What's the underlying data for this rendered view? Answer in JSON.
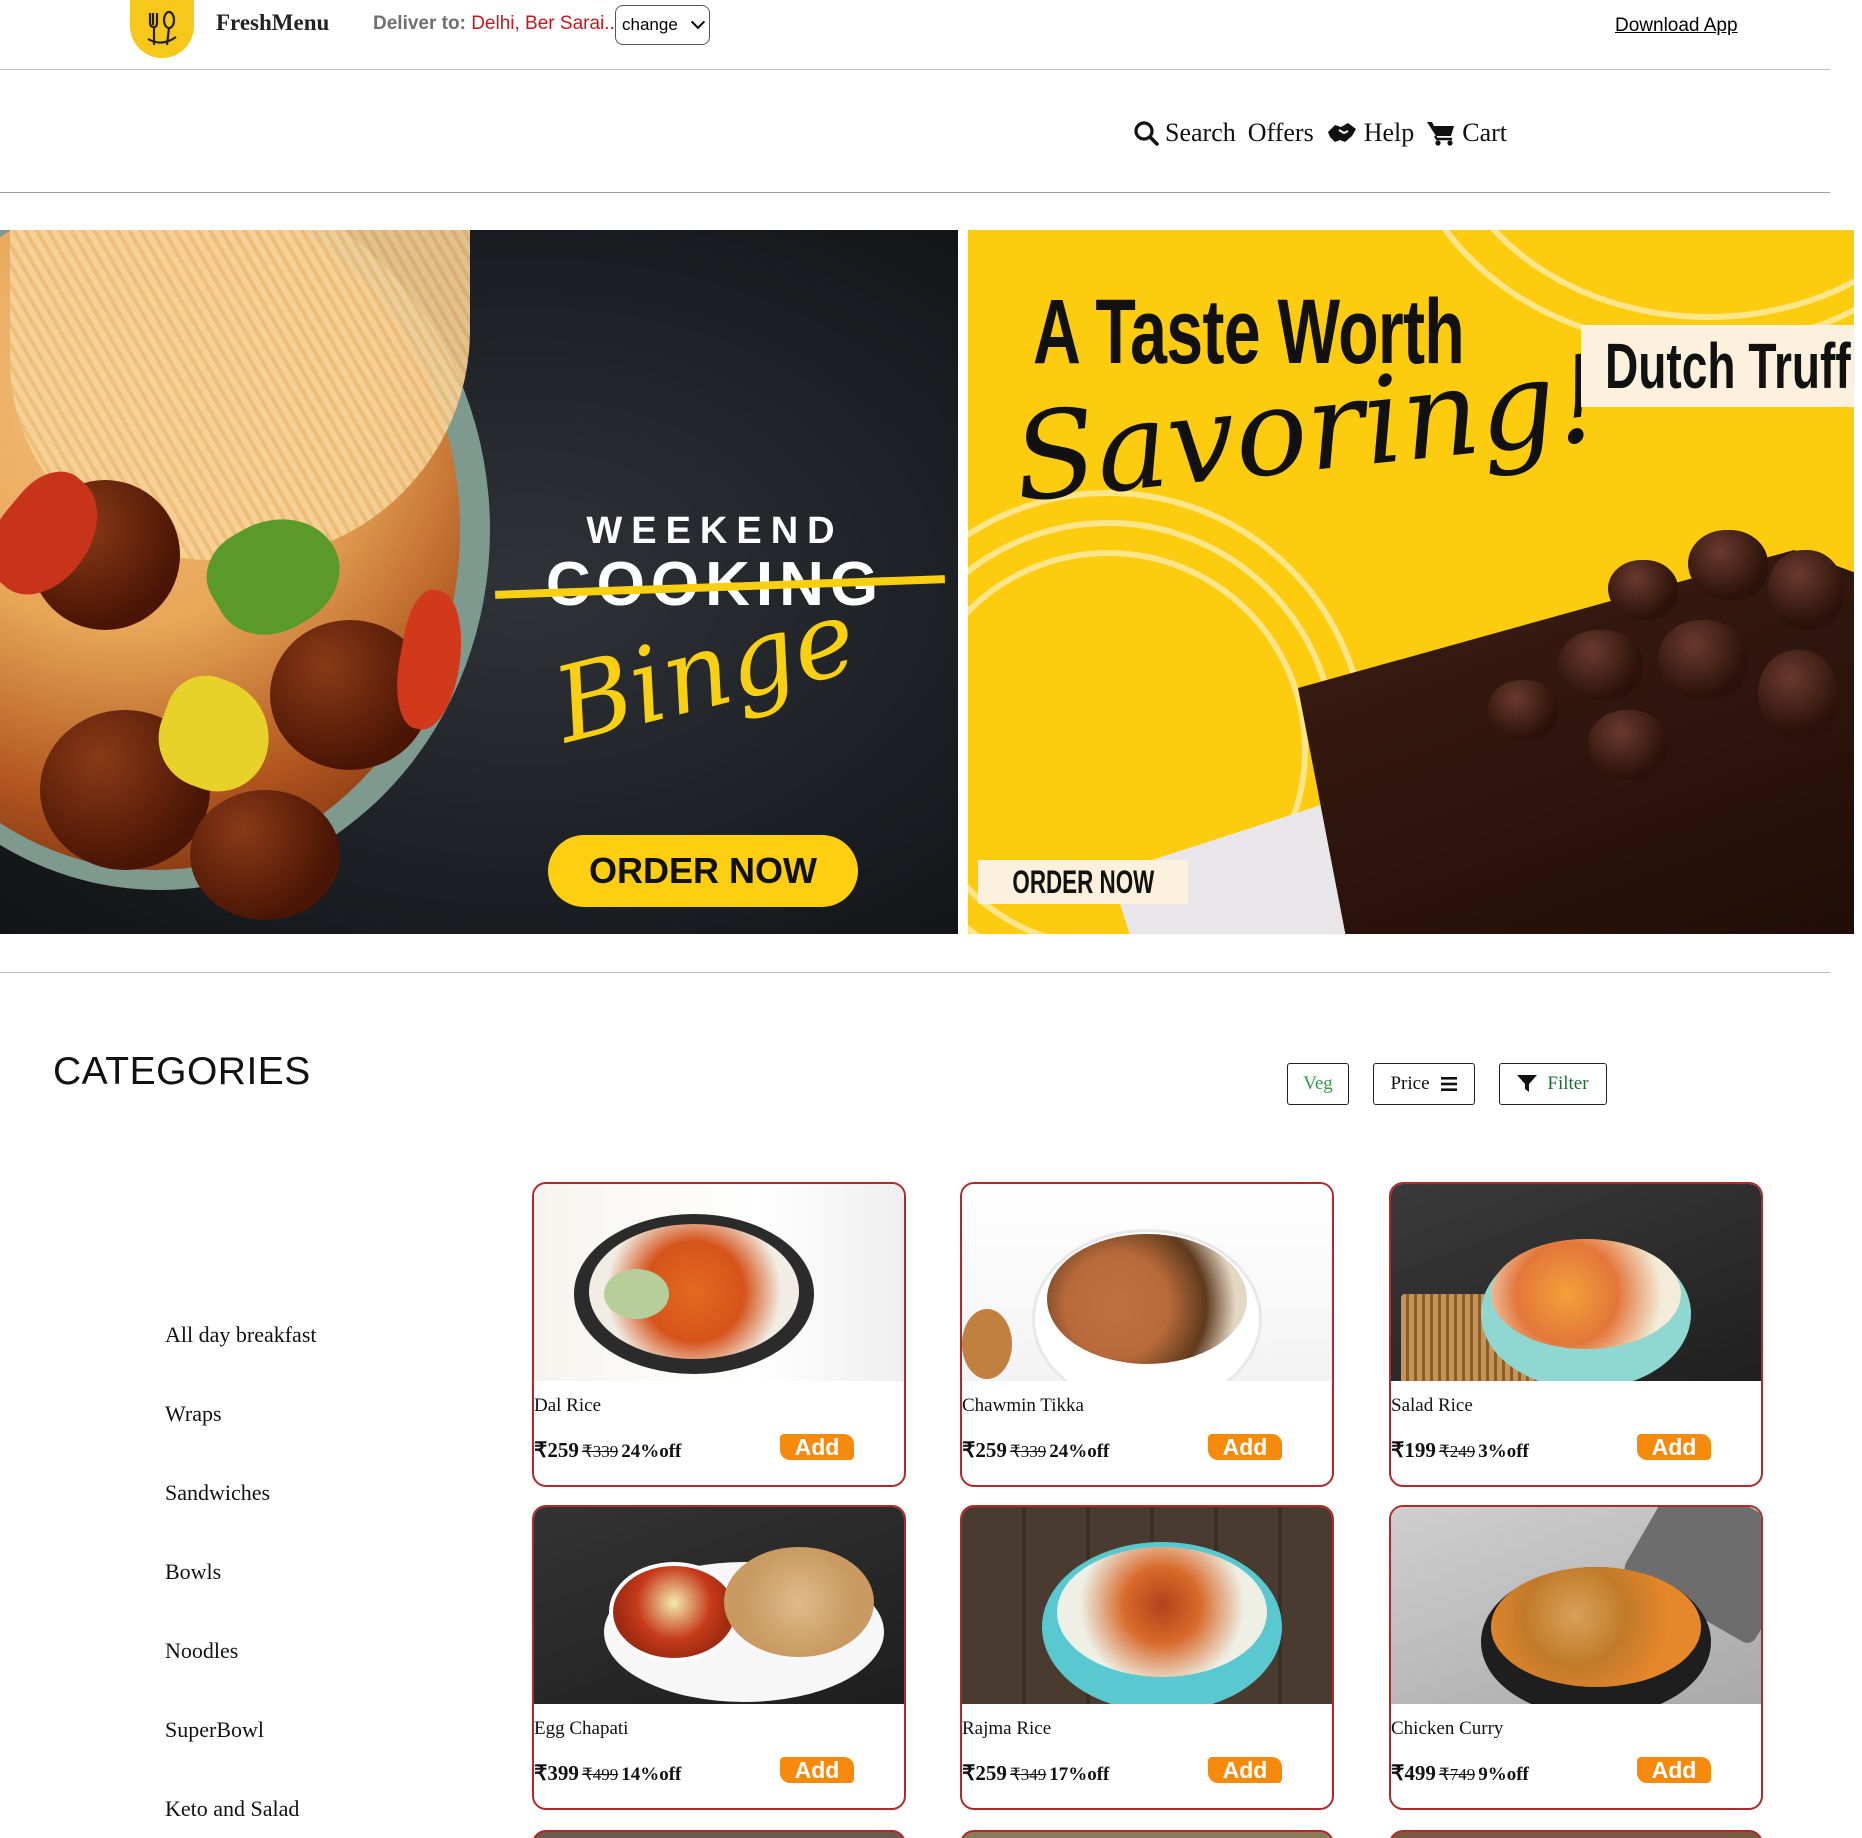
{
  "header": {
    "brand": "FreshMenu",
    "deliver_label": "Deliver to:",
    "deliver_location": "Delhi, Ber Sarai..",
    "change_select": "change",
    "download_app": "Download App"
  },
  "nav": {
    "search": "Search",
    "offers": "Offers",
    "help": "Help",
    "cart": "Cart"
  },
  "banners": {
    "left": {
      "line1": "WEEKEND",
      "line2": "COOKING",
      "line3": "Binge",
      "cta": "ORDER NOW"
    },
    "right": {
      "line1": "A Taste Worth",
      "line2": "Savoring!",
      "tag": "Dutch Truffle",
      "cta": "ORDER NOW"
    }
  },
  "categories": {
    "title": "CATEGORIES",
    "filters": {
      "veg": "Veg",
      "price": "Price",
      "filter": "Filter"
    },
    "items": [
      "All day breakfast",
      "Wraps",
      "Sandwiches",
      "Bowls",
      "Noodles",
      "SuperBowl",
      "Keto and Salad"
    ]
  },
  "products": [
    {
      "name": "Dal Rice",
      "price": "₹259",
      "old_price": "₹339",
      "discount": "24%off",
      "add": "Add"
    },
    {
      "name": "Chawmin Tikka",
      "price": "₹259",
      "old_price": "₹339",
      "discount": "24%off",
      "add": "Add"
    },
    {
      "name": "Salad Rice",
      "price": "₹199",
      "old_price": "₹249",
      "discount": "3%off",
      "add": "Add"
    },
    {
      "name": "Egg Chapati",
      "price": "₹399",
      "old_price": "₹499",
      "discount": "14%off",
      "add": "Add"
    },
    {
      "name": "Rajma Rice",
      "price": "₹259",
      "old_price": "₹349",
      "discount": "17%off",
      "add": "Add"
    },
    {
      "name": "Chicken Curry",
      "price": "₹499",
      "old_price": "₹749",
      "discount": "9%off",
      "add": "Add"
    }
  ],
  "colors": {
    "accent_orange": "#f68a0c",
    "card_border": "#b12a2a",
    "location_red": "#c8161e",
    "veg_green": "#2e9d4c",
    "banner_yellow": "#fdcc0e"
  }
}
